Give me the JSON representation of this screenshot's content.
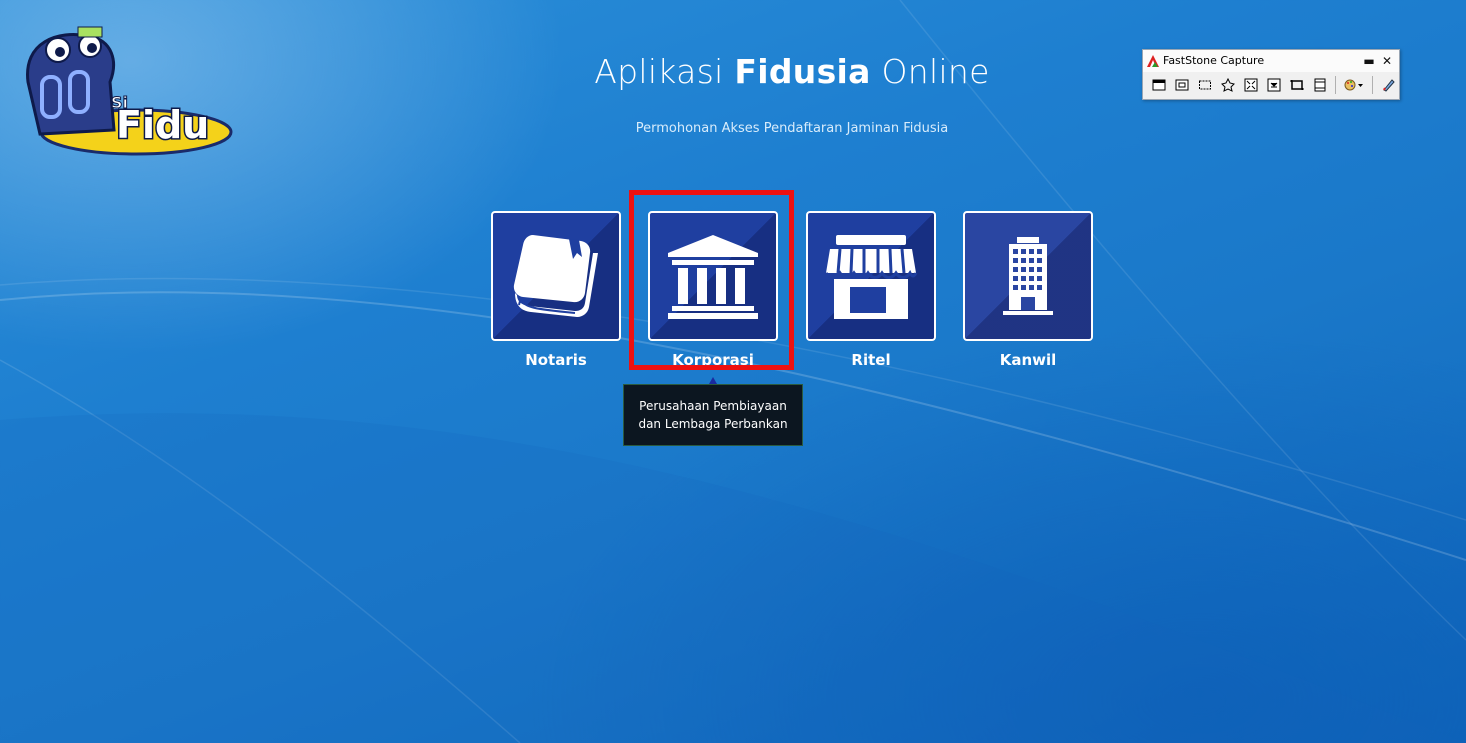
{
  "page": {
    "title_prefix": "Aplikasi",
    "title_bold": "Fidusia",
    "title_suffix": "Online",
    "subtitle": "Permohonan Akses Pendaftaran Jaminan Fidusia"
  },
  "logo": {
    "text_small": "Si",
    "text_big": "Fidu",
    "icon": "sifidu-logo"
  },
  "tiles": [
    {
      "label": "Notaris",
      "icon": "book-icon"
    },
    {
      "label": "Korporasi",
      "icon": "bank-building-icon"
    },
    {
      "label": "Ritel",
      "icon": "shop-icon"
    },
    {
      "label": "Kanwil",
      "icon": "office-building-icon"
    }
  ],
  "tooltip": {
    "line1": "Perusahaan Pembiayaan",
    "line2": "dan Lembaga Perbankan"
  },
  "faststone": {
    "title": "FastStone Capture",
    "min_label": "▬",
    "close_label": "✕"
  },
  "colors": {
    "background": "#1e7fd0",
    "tile": "#1f3fa0",
    "highlight": "#ee1111",
    "tooltip_bg": "#0c1620"
  }
}
